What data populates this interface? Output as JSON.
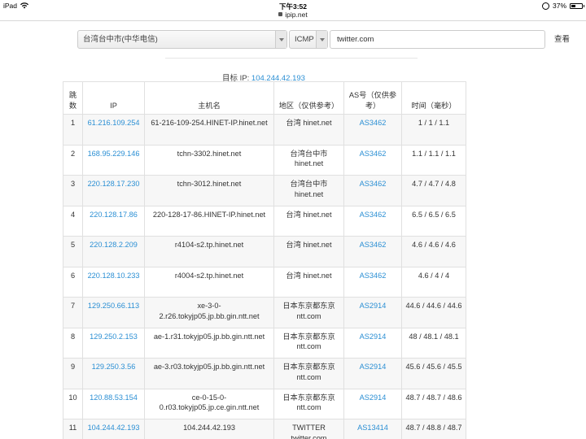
{
  "status_bar": {
    "device": "iPad",
    "time": "下午3:52",
    "battery": "37%",
    "battery_level": 0.37
  },
  "url_bar": {
    "domain": "ipip.net"
  },
  "search": {
    "location_select": "台湾台中市(中华电信)",
    "protocol_select": "ICMP",
    "target_input": "twitter.com",
    "query_button": "查看"
  },
  "target_line": {
    "label": "目标 IP:",
    "ip": "104.244.42.193"
  },
  "table": {
    "headers": [
      "跳数",
      "IP",
      "主机名",
      "地区（仅供参考）",
      "AS号（仅供参考）",
      "时间（毫秒）"
    ],
    "rows": [
      {
        "hop": "1",
        "ip": "61.216.109.254",
        "host": "61-216-109-254.HINET-IP.hinet.net",
        "region": "台湾 hinet.net",
        "as": "AS3462",
        "time": "1 / 1 / 1.1"
      },
      {
        "hop": "2",
        "ip": "168.95.229.146",
        "host": "tchn-3302.hinet.net",
        "region": "台湾台中市 hinet.net",
        "as": "AS3462",
        "time": "1.1 / 1.1 / 1.1"
      },
      {
        "hop": "3",
        "ip": "220.128.17.230",
        "host": "tchn-3012.hinet.net",
        "region": "台湾台中市 hinet.net",
        "as": "AS3462",
        "time": "4.7 / 4.7 / 4.8"
      },
      {
        "hop": "4",
        "ip": "220.128.17.86",
        "host": "220-128-17-86.HINET-IP.hinet.net",
        "region": "台湾 hinet.net",
        "as": "AS3462",
        "time": "6.5 / 6.5 / 6.5"
      },
      {
        "hop": "5",
        "ip": "220.128.2.209",
        "host": "r4104-s2.tp.hinet.net",
        "region": "台湾 hinet.net",
        "as": "AS3462",
        "time": "4.6 / 4.6 / 4.6"
      },
      {
        "hop": "6",
        "ip": "220.128.10.233",
        "host": "r4004-s2.tp.hinet.net",
        "region": "台湾 hinet.net",
        "as": "AS3462",
        "time": "4.6 / 4 / 4"
      },
      {
        "hop": "7",
        "ip": "129.250.66.113",
        "host": "xe-3-0-2.r26.tokyjp05.jp.bb.gin.ntt.net",
        "region": "日本东京都东京 ntt.com",
        "as": "AS2914",
        "time": "44.6 / 44.6 / 44.6"
      },
      {
        "hop": "8",
        "ip": "129.250.2.153",
        "host": "ae-1.r31.tokyjp05.jp.bb.gin.ntt.net",
        "region": "日本东京都东京 ntt.com",
        "as": "AS2914",
        "time": "48 / 48.1 / 48.1"
      },
      {
        "hop": "9",
        "ip": "129.250.3.56",
        "host": "ae-3.r03.tokyjp05.jp.bb.gin.ntt.net",
        "region": "日本东京都东京 ntt.com",
        "as": "AS2914",
        "time": "45.6 / 45.6 / 45.5"
      },
      {
        "hop": "10",
        "ip": "120.88.53.154",
        "host": "ce-0-15-0-0.r03.tokyjp05.jp.ce.gin.ntt.net",
        "region": "日本东京都东京 ntt.com",
        "as": "AS2914",
        "time": "48.7 / 48.7 / 48.6"
      },
      {
        "hop": "11",
        "ip": "104.244.42.193",
        "host": "104.244.42.193",
        "region": "TWITTER twitter.com",
        "as": "AS13414",
        "time": "48.7 / 48.8 / 48.7"
      }
    ]
  },
  "colors": {
    "link": "#2b8fd4",
    "row_stripe": "#f7f7f7",
    "border": "#e0e0e0"
  }
}
